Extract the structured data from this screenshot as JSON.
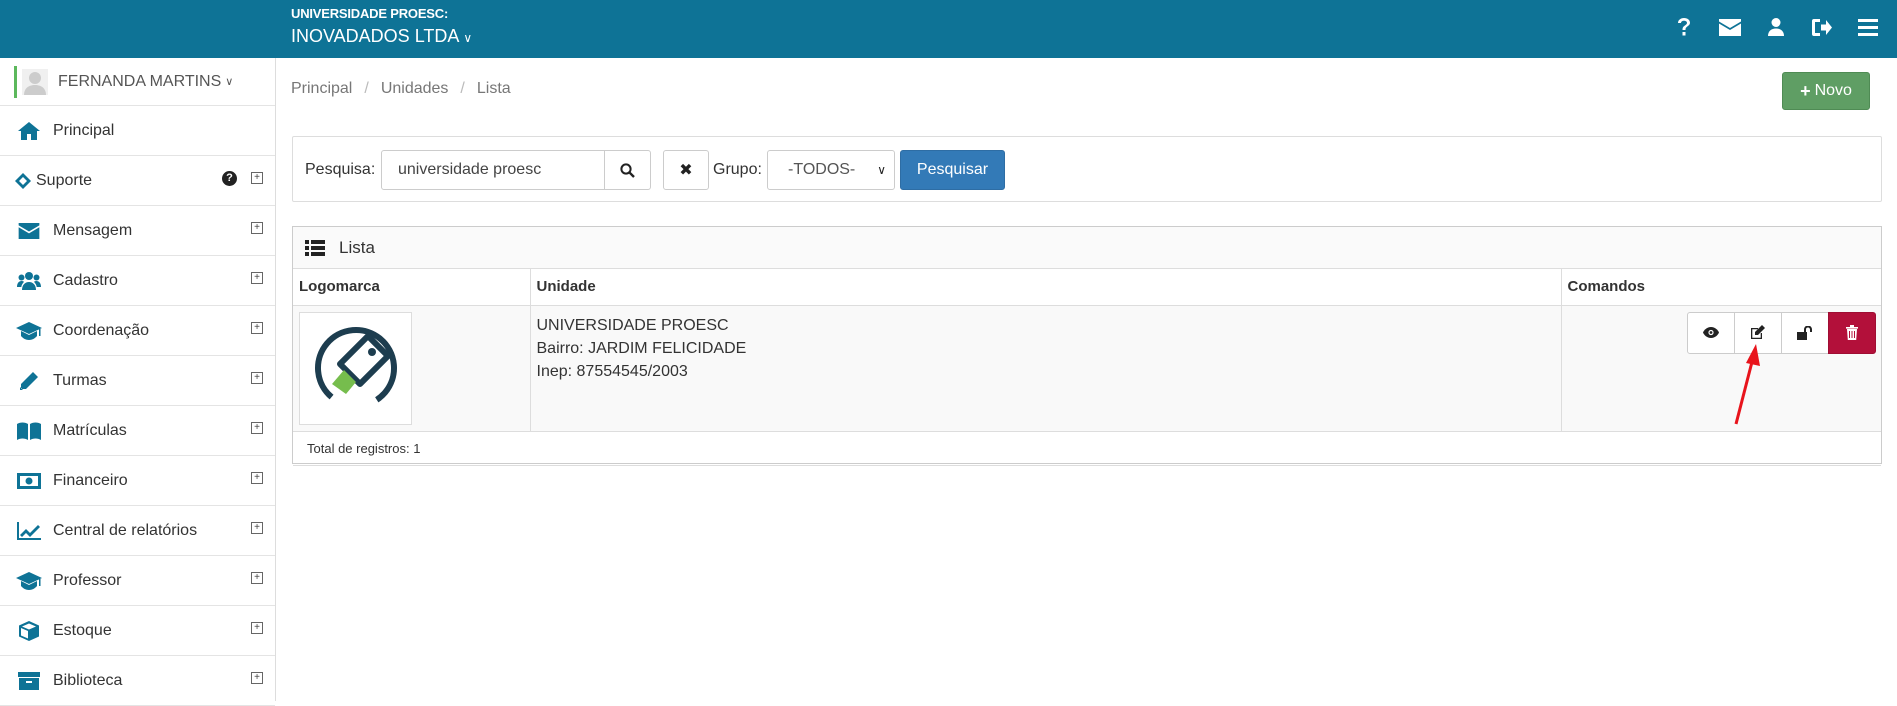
{
  "header": {
    "org_sub": "UNIVERSIDADE PROESC:",
    "org_main": "INOVADADOS LTDA",
    "icons": [
      "question-icon",
      "envelope-icon",
      "user-icon",
      "sign-out-icon",
      "menu-icon"
    ]
  },
  "sidebar": {
    "user_name": "FERNANDA MARTINS",
    "items": [
      {
        "label": "Principal",
        "icon": "home-icon"
      },
      {
        "label": "Suporte",
        "icon": "ticket-icon"
      },
      {
        "label": "Mensagem",
        "icon": "envelope-icon"
      },
      {
        "label": "Cadastro",
        "icon": "users-icon"
      },
      {
        "label": "Coordenação",
        "icon": "graduation-cap-icon"
      },
      {
        "label": "Turmas",
        "icon": "pencil-icon"
      },
      {
        "label": "Matrículas",
        "icon": "book-icon"
      },
      {
        "label": "Financeiro",
        "icon": "money-icon"
      },
      {
        "label": "Central de relatórios",
        "icon": "line-chart-icon"
      },
      {
        "label": "Professor",
        "icon": "graduation-cap-icon"
      },
      {
        "label": "Estoque",
        "icon": "cube-icon"
      },
      {
        "label": "Biblioteca",
        "icon": "archive-icon"
      }
    ]
  },
  "breadcrumb": [
    "Principal",
    "Unidades",
    "Lista"
  ],
  "toolbar": {
    "novo_label": "Novo"
  },
  "search": {
    "label": "Pesquisa:",
    "value": "universidade proesc",
    "group_label": "Grupo:",
    "group_value": "-TODOS-",
    "submit_label": "Pesquisar"
  },
  "list": {
    "title": "Lista",
    "columns": [
      "Logomarca",
      "Unidade",
      "Comandos"
    ],
    "rows": [
      {
        "name": "UNIVERSIDADE PROESC",
        "bairro": "Bairro: JARDIM FELICIDADE",
        "inep": "Inep: 87554545/2003"
      }
    ],
    "total": "Total de registros: 1"
  },
  "colors": {
    "header_bg": "#0e7396",
    "primary_button": "#337ab7",
    "success_button": "#5f9e64",
    "danger_button": "#b3103a",
    "annotation_arrow": "#e8141c"
  }
}
